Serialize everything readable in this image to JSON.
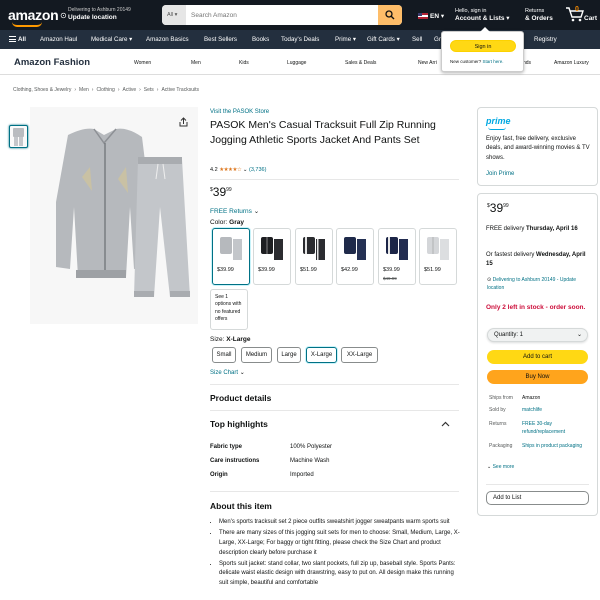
{
  "header": {
    "logo_text": "amazon",
    "deliver_line1": "Delivering to Ashburn 20149",
    "deliver_line2": "Update location",
    "search_category": "All",
    "search_placeholder": "Search Amazon",
    "language": "EN",
    "account_line1": "Hello, sign in",
    "account_line2": "Account & Lists",
    "returns_line1": "Returns",
    "returns_line2": "& Orders",
    "cart_count": "0",
    "cart_label": "Cart"
  },
  "subnav": {
    "all_label": "All",
    "items": [
      "Amazon Haul",
      "Medical Care",
      "Amazon Basics",
      "Best Sellers",
      "Books",
      "Today's Deals",
      "Prime",
      "Gift Cards",
      "Sell",
      "Gr",
      "Registry"
    ]
  },
  "signin_popover": {
    "button": "Sign in",
    "new_customer": "New customer?",
    "start_here": "Start here."
  },
  "fashion_bar": {
    "title": "Amazon Fashion",
    "links": [
      "Women",
      "Men",
      "Kids",
      "Luggage",
      "Sales & Deals",
      "New Arri",
      "nds",
      "Amazon Luxury"
    ]
  },
  "breadcrumb": [
    "Clothing, Shoes & Jewelry",
    "Men",
    "Clothing",
    "Active",
    "Sets",
    "Active Tracksuits"
  ],
  "product": {
    "store_link": "Visit the PASOK Store",
    "title": "PASOK Men's Casual Tracksuit Full Zip Running Jogging Athletic Sports Jacket And Pants Set",
    "rating": "4.2",
    "rating_count": "(3,736)",
    "price_symbol": "$",
    "price_whole": "39",
    "price_fraction": "99",
    "free_returns": "FREE Returns",
    "color_label": "Color:",
    "color_value": "Gray",
    "swatches": [
      {
        "price": "$39.99",
        "old": ""
      },
      {
        "price": "$39.99",
        "old": ""
      },
      {
        "price": "$51.99",
        "old": ""
      },
      {
        "price": "$42.99",
        "old": ""
      },
      {
        "price": "$39.99",
        "old": "$49.99"
      },
      {
        "price": "$51.99",
        "old": ""
      }
    ],
    "see_options": "See 1 options with no featured offers",
    "size_label": "Size:",
    "size_value": "X-Large",
    "sizes": [
      "Small",
      "Medium",
      "Large",
      "X-Large",
      "XX-Large"
    ],
    "size_chart": "Size Chart",
    "details_heading": "Product details",
    "highlights_heading": "Top highlights",
    "specs": [
      {
        "key": "Fabric type",
        "value": "100% Polyester"
      },
      {
        "key": "Care instructions",
        "value": "Machine Wash"
      },
      {
        "key": "Origin",
        "value": "Imported"
      }
    ],
    "about_heading": "About this item",
    "bullets": [
      "Men's sports tracksuit set 2 piece outfits sweatshirt jogger sweatpants warm sports suit",
      "There are many sizes of this jogging suit sets for men to choose: Small, Medium, Large, X-Large, XX-Large; For baggy or tight fitting, please check the Size Chart and product description clearly before purchase it",
      "Sports suit jacket: stand collar, two slant pockets, full zip up, baseball style. Sports Pants: delicate waist elastic design with drawstring, easy to put on. All design make this running suit simple, beautiful and comfortable"
    ]
  },
  "prime_box": {
    "logo": "prime",
    "text": "Enjoy fast, free delivery, exclusive deals, and award-winning movies & TV shows.",
    "join": "Join Prime"
  },
  "buy_box": {
    "price_symbol": "$",
    "price_whole": "39",
    "price_fraction": "99",
    "free_delivery_prefix": "FREE delivery",
    "free_delivery_date": "Thursday, April 16",
    "fastest_prefix": "Or fastest delivery",
    "fastest_date": "Wednesday, April 15",
    "deliver_to": "Delivering to Ashburn 20149 - Update location",
    "stock": "Only 2 left in stock - order soon.",
    "quantity": "Quantity: 1",
    "add_to_cart": "Add to cart",
    "buy_now": "Buy Now",
    "ships_from_key": "Ships from",
    "ships_from_val": "Amazon",
    "sold_by_key": "Sold by",
    "sold_by_val": "matchlife",
    "returns_key": "Returns",
    "returns_val": "FREE 30-day refund/replacement",
    "packaging_key": "Packaging",
    "packaging_val": "Ships in product packaging",
    "see_more": "See more",
    "add_to_list": "Add to List"
  },
  "colors": {
    "nav_bg": "#131921",
    "subnav_bg": "#232f3e",
    "accent": "#ff9900",
    "link": "#007185",
    "add_to_cart": "#ffd814",
    "buy_now": "#ffa41c",
    "stock_red": "#cc0c39"
  }
}
